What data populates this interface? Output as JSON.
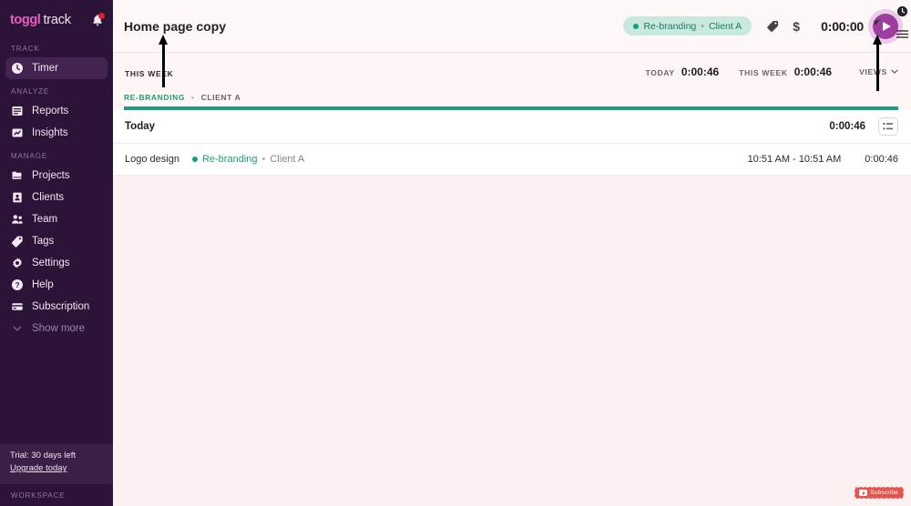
{
  "brand": {
    "logo_first": "toggl",
    "logo_second": "track",
    "accent_pink": "#e85fc0",
    "sidebar_bg": "#2c1338",
    "project_green": "#1c9e7e",
    "play_purple": "#9e3d9e"
  },
  "sidebar": {
    "notification_icon": "bell-icon",
    "sections": [
      {
        "label": "TRACK",
        "items": [
          {
            "label": "Timer",
            "icon": "clock-icon",
            "active": true
          }
        ]
      },
      {
        "label": "ANALYZE",
        "items": [
          {
            "label": "Reports",
            "icon": "reports-icon",
            "active": false
          },
          {
            "label": "Insights",
            "icon": "insights-icon",
            "active": false
          }
        ]
      },
      {
        "label": "MANAGE",
        "items": [
          {
            "label": "Projects",
            "icon": "folder-icon",
            "active": false
          },
          {
            "label": "Clients",
            "icon": "person-card-icon",
            "active": false
          },
          {
            "label": "Team",
            "icon": "people-icon",
            "active": false
          },
          {
            "label": "Tags",
            "icon": "tag-icon",
            "active": false
          },
          {
            "label": "Settings",
            "icon": "gear-icon",
            "active": false
          },
          {
            "label": "Help",
            "icon": "question-circle-icon",
            "active": false
          },
          {
            "label": "Subscription",
            "icon": "card-icon",
            "active": false
          },
          {
            "label": "Show more",
            "icon": "chevron-down-icon",
            "active": false,
            "muted": true
          }
        ]
      }
    ],
    "trial": {
      "text": "Trial: 30 days left",
      "upgrade_link": "Upgrade today"
    },
    "workspace_label": "WORKSPACE"
  },
  "timer_bar": {
    "description": "Home page copy",
    "project_pill": {
      "project": "Re-branding",
      "separator": "•",
      "client": "Client A"
    },
    "tag_icon": "tag-icon",
    "billable_icon": "dollar-icon",
    "elapsed": "0:00:00",
    "play_icon": "play-icon",
    "edge_icons": [
      "clock-icon",
      "hamburger-menu-icon"
    ]
  },
  "week_bar": {
    "this_week_label": "THIS WEEK",
    "today": {
      "label": "TODAY",
      "value": "0:00:46"
    },
    "week": {
      "label": "THIS WEEK",
      "value": "0:00:46"
    },
    "views_button": "VIEWS",
    "views_chevron_icon": "chevron-down-icon",
    "bar_project": "RE-BRANDING",
    "bar_separator": "•",
    "bar_client": "CLIENT A"
  },
  "entries": {
    "day_header": {
      "title": "Today",
      "total": "0:00:46"
    },
    "view_toggle_icon": "list-view-icon",
    "rows": [
      {
        "description": "Logo design",
        "project": "Re-branding",
        "separator": "•",
        "client": "Client A",
        "times": "10:51 AM - 10:51 AM",
        "duration": "0:00:46"
      }
    ]
  },
  "overlay": {
    "subscribe_label": "Subscribe",
    "subscribe_icon": "youtube-play-icon",
    "annotation_arrows": 2
  }
}
